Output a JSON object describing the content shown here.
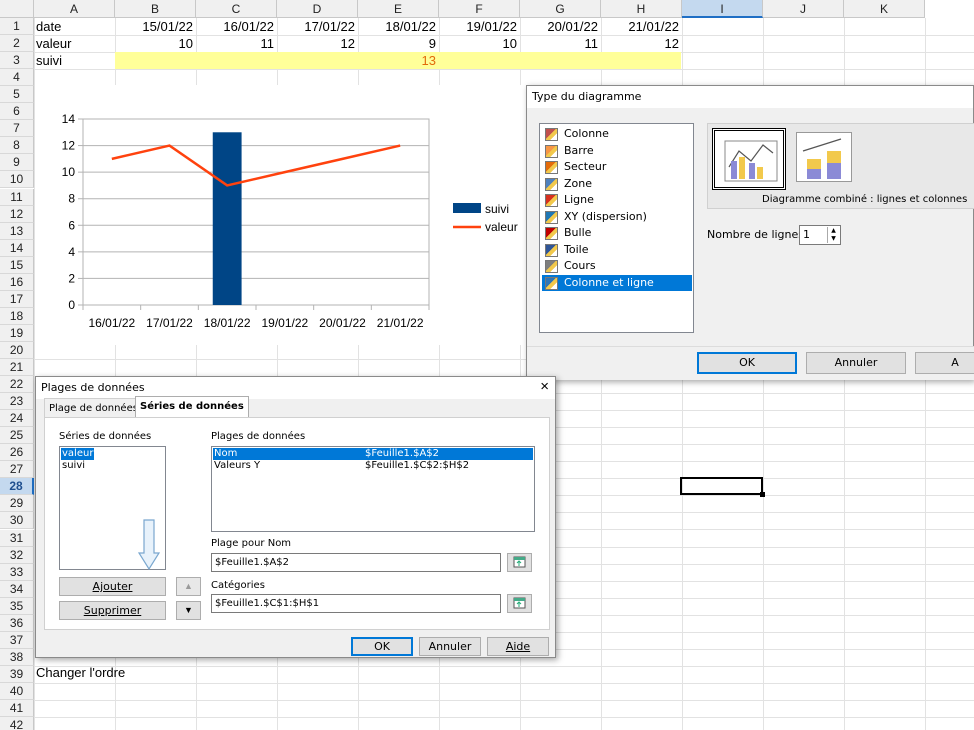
{
  "sheet": {
    "columns": [
      "A",
      "B",
      "C",
      "D",
      "E",
      "F",
      "G",
      "H",
      "I",
      "J",
      "K"
    ],
    "selected_column": "I",
    "rows": [
      "1",
      "2",
      "3",
      "4",
      "5",
      "6",
      "7",
      "8",
      "9",
      "10",
      "11",
      "12",
      "13",
      "14",
      "15",
      "16",
      "17",
      "18",
      "19",
      "20",
      "21",
      "22",
      "23",
      "24",
      "25",
      "26",
      "27",
      "28",
      "29",
      "30",
      "31",
      "32",
      "33",
      "34",
      "35",
      "36",
      "37",
      "38",
      "39",
      "40",
      "41",
      "42"
    ],
    "selected_row": "28",
    "row1": [
      "date",
      "15/01/22",
      "16/01/22",
      "17/01/22",
      "18/01/22",
      "19/01/22",
      "20/01/22",
      "21/01/22"
    ],
    "row2": [
      "valeur",
      "10",
      "11",
      "12",
      "9",
      "10",
      "11",
      "12"
    ],
    "row3_label": "suivi",
    "row3_value": "13",
    "row3_value_color": "#e26b0a",
    "row39": "Changer l'ordre",
    "highlight_color": "#ffff99"
  },
  "chart_data": {
    "type": "bar+line",
    "categories": [
      "16/01/22",
      "17/01/22",
      "18/01/22",
      "19/01/22",
      "20/01/22",
      "21/01/22"
    ],
    "series": [
      {
        "name": "suivi",
        "kind": "bar",
        "values": [
          null,
          null,
          13,
          null,
          null,
          null
        ],
        "color": "#004586"
      },
      {
        "name": "valeur",
        "kind": "line",
        "values": [
          11,
          12,
          9,
          10,
          11,
          12
        ],
        "color": "#ff420e"
      }
    ],
    "ylim": [
      0,
      14
    ],
    "yticks": [
      "0",
      "2",
      "4",
      "6",
      "8",
      "10",
      "12",
      "14"
    ],
    "grid": true,
    "legend": "right"
  },
  "type_dialog": {
    "title": "Type du diagramme",
    "types": [
      {
        "label": "Colonne",
        "icon": "column-chart-icon"
      },
      {
        "label": "Barre",
        "icon": "bar-chart-icon"
      },
      {
        "label": "Secteur",
        "icon": "pie-chart-icon"
      },
      {
        "label": "Zone",
        "icon": "area-chart-icon"
      },
      {
        "label": "Ligne",
        "icon": "line-chart-icon"
      },
      {
        "label": "XY (dispersion)",
        "icon": "scatter-chart-icon"
      },
      {
        "label": "Bulle",
        "icon": "bubble-chart-icon"
      },
      {
        "label": "Toile",
        "icon": "net-chart-icon"
      },
      {
        "label": "Cours",
        "icon": "stock-chart-icon"
      },
      {
        "label": "Colonne et ligne",
        "icon": "column-line-chart-icon"
      }
    ],
    "selected_type": "Colonne et ligne",
    "variant_caption": "Diagramme combiné : lignes et colonnes",
    "lines_label": "Nombre de lignes",
    "lines_value": "1",
    "ok": "OK",
    "cancel": "Annuler",
    "help_partial": "A"
  },
  "ranges_dialog": {
    "title": "Plages de données",
    "close": "×",
    "tabs": [
      "Plage de données",
      "Séries de données"
    ],
    "active_tab": "Séries de données",
    "series_label": "Séries de données",
    "series": [
      "valeur",
      "suivi"
    ],
    "ranges_label": "Plages de données",
    "ranges": [
      {
        "role": "Nom",
        "range": "$Feuille1.$A$2"
      },
      {
        "role": "Valeurs Y",
        "range": "$Feuille1.$C$2:$H$2"
      }
    ],
    "name_range_label": "Plage pour Nom",
    "name_range_value": "$Feuille1.$A$2",
    "categories_label": "Catégories",
    "categories_value": "$Feuille1.$C$1:$H$1",
    "add": "Ajouter",
    "remove": "Supprimer",
    "ok": "OK",
    "cancel": "Annuler",
    "help": "Aide"
  }
}
